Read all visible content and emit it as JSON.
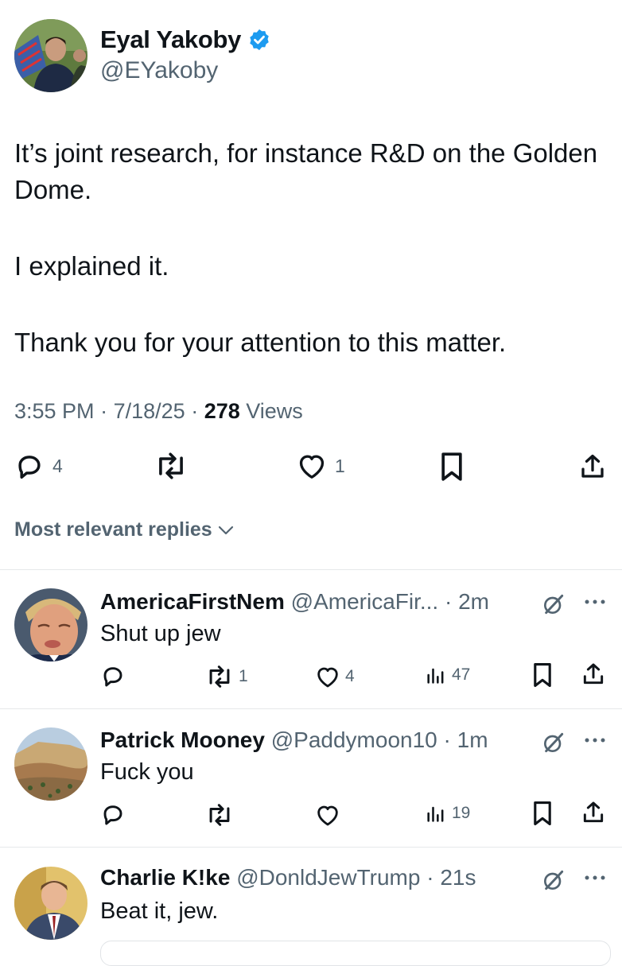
{
  "tweet": {
    "author_name": "Eyal Yakoby",
    "author_handle": "@EYakoby",
    "text": [
      "It’s joint research, for instance R&D on the Golden Dome.",
      "I explained it.",
      "Thank you for your attention to this matter."
    ],
    "time": "3:55 PM",
    "date": "7/18/25",
    "views_count": "278",
    "views_label": "Views",
    "replies": "4",
    "retweets": "",
    "likes": "1"
  },
  "replies_sort": {
    "label": "Most relevant replies"
  },
  "replies": [
    {
      "name": "AmericaFirstNem",
      "handle": "@AmericaFir...",
      "time": "2m",
      "text": "Shut up jew",
      "replies": "",
      "retweets": "1",
      "likes": "4",
      "views": "47"
    },
    {
      "name": "Patrick Mooney",
      "handle": "@Paddymoon10",
      "time": "1m",
      "text": "Fuck you",
      "replies": "",
      "retweets": "",
      "likes": "",
      "views": "19"
    },
    {
      "name": "Charlie K!ke",
      "handle": "@DonldJewTrump",
      "time": "21s",
      "text": "Beat it, jew."
    }
  ],
  "colors": {
    "verified_blue": "#1d9bf0",
    "text_primary": "#0f1419",
    "text_secondary": "#536471"
  },
  "icons": [
    "verified-badge-icon",
    "reply-icon",
    "retweet-icon",
    "like-icon",
    "bookmark-icon",
    "share-icon",
    "views-icon",
    "grok-icon",
    "more-icon",
    "chevron-down-icon"
  ]
}
